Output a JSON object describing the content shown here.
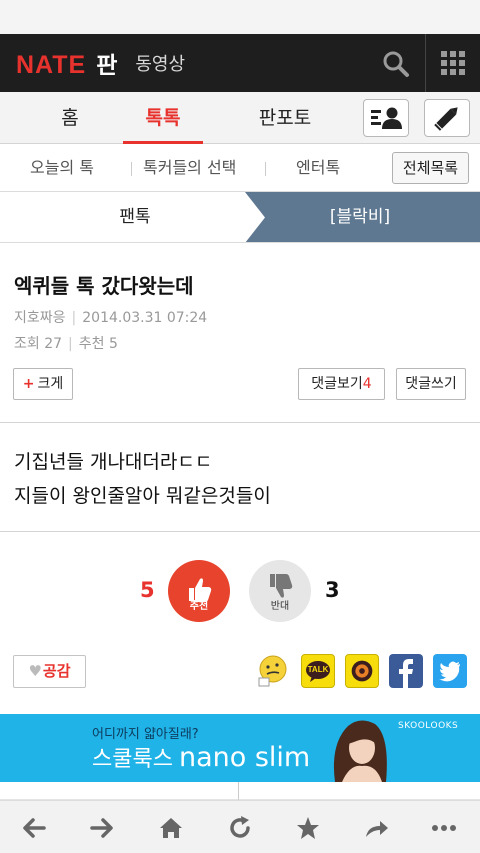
{
  "header": {
    "logo_nate": "NATE",
    "logo_pan": "판",
    "video_label": "동영상"
  },
  "tabs": [
    {
      "label": "홈"
    },
    {
      "label": "톡톡",
      "active": true
    },
    {
      "label": "판포토"
    }
  ],
  "subnav": {
    "items": [
      "오늘의 톡",
      "톡커들의 선택",
      "엔터톡"
    ],
    "all_list": "전체목록"
  },
  "category": {
    "left": "팬톡",
    "right": "[블락비]"
  },
  "article": {
    "title": "엑퀴들 톡 갔다왓는데",
    "author": "지호짜응",
    "date": "2014.03.31 07:24",
    "views": "조회 27",
    "recommends": "추천 5",
    "bigger_label": "크게",
    "bigger_plus": "+",
    "comment_view_label": "댓글보기",
    "comment_count": "4",
    "comment_write_label": "댓글쓰기",
    "body_lines": [
      "기집년들 개나대더라ㄷㄷ",
      "지들이 왕인줄알아 뭐같은것들이"
    ]
  },
  "vote": {
    "up_count": "5",
    "up_label": "추천",
    "down_label": "반대",
    "down_count": "3"
  },
  "share": {
    "like_label": "공감",
    "like_heart": "♥",
    "kakao_label": "TALK",
    "icons": [
      "emoji-icon",
      "kakaotalk-icon",
      "kakaostory-icon",
      "facebook-icon",
      "twitter-icon"
    ]
  },
  "ad": {
    "top_text": "어디까지 얇아질래?",
    "main_ko": "스쿨룩스",
    "main_en": "nano slim",
    "brand": "SKOOLOOKS"
  },
  "colors": {
    "accent": "#e8322d",
    "nav_bg": "#1e1e1e",
    "category_active": "#5f7891",
    "ad_bg": "#1fb3e8"
  }
}
